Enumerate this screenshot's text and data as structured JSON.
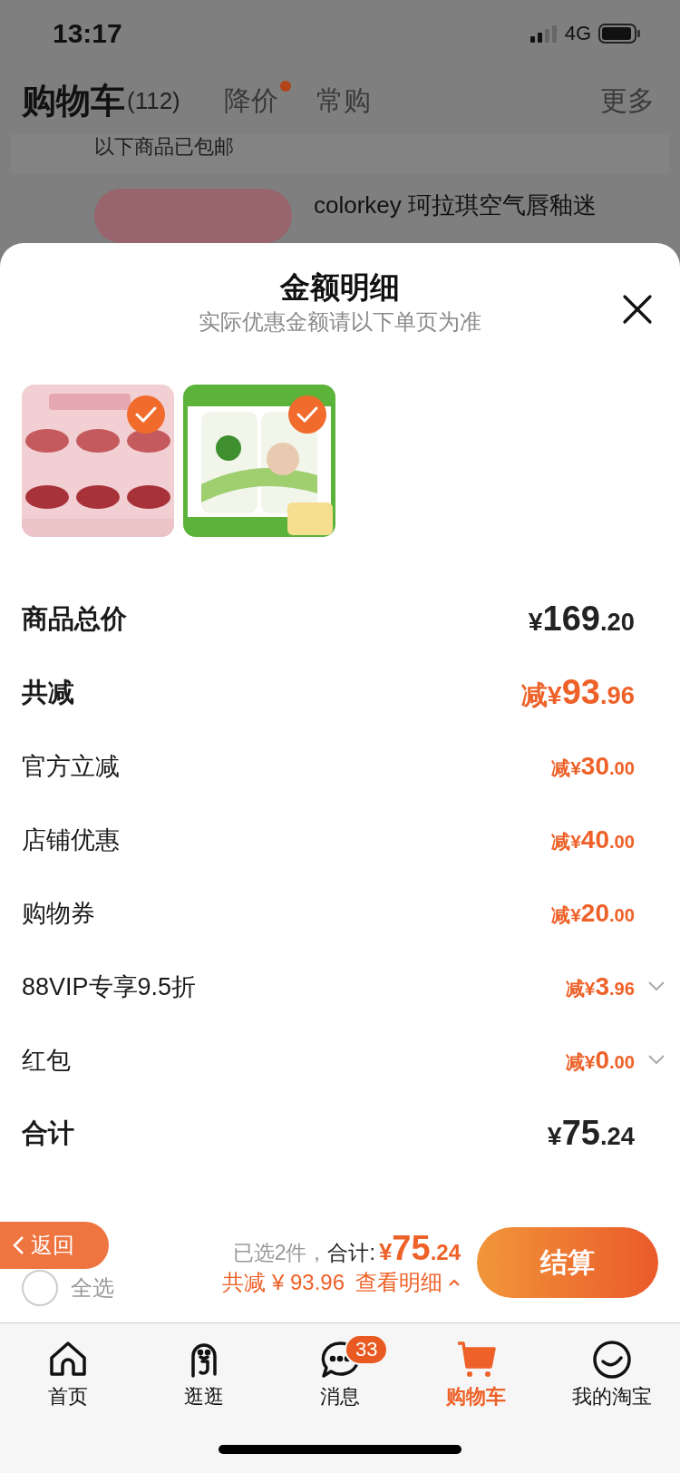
{
  "status_bar": {
    "time": "13:17",
    "network": "4G"
  },
  "header": {
    "title": "购物车",
    "count": "(112)",
    "tabs": [
      {
        "label": "降价",
        "dot": true
      },
      {
        "label": "常购",
        "dot": false
      }
    ],
    "more": "更多"
  },
  "background_cart": {
    "notice": "以下商品已包邮",
    "product_title": "colorkey 珂拉琪空气唇釉迷"
  },
  "sheet": {
    "title": "金额明细",
    "subtitle": "实际优惠金额请以下单页为准",
    "items": [
      {
        "kind": "picture",
        "checked": true
      },
      {
        "kind": "picture",
        "checked": true
      }
    ],
    "rows": [
      {
        "label": "商品总价",
        "major": true,
        "discount": false,
        "prefix": "",
        "currency": "¥",
        "integer": "169",
        "decimal": ".20",
        "expandable": false
      },
      {
        "label": "共减",
        "major": true,
        "discount": true,
        "prefix": "减",
        "currency": "¥",
        "integer": "93",
        "decimal": ".96",
        "expandable": false
      },
      {
        "label": "官方立减",
        "major": false,
        "discount": true,
        "prefix": "减",
        "currency": "¥",
        "integer": "30",
        "decimal": ".00",
        "expandable": false
      },
      {
        "label": "店铺优惠",
        "major": false,
        "discount": true,
        "prefix": "减",
        "currency": "¥",
        "integer": "40",
        "decimal": ".00",
        "expandable": false
      },
      {
        "label": "购物券",
        "major": false,
        "discount": true,
        "prefix": "减",
        "currency": "¥",
        "integer": "20",
        "decimal": ".00",
        "expandable": false
      },
      {
        "label": "88VIP专享9.5折",
        "major": false,
        "discount": true,
        "prefix": "减",
        "currency": "¥",
        "integer": "3",
        "decimal": ".96",
        "expandable": true
      },
      {
        "label": "红包",
        "major": false,
        "discount": true,
        "prefix": "减",
        "currency": "¥",
        "integer": "0",
        "decimal": ".00",
        "expandable": true
      },
      {
        "label": "合计",
        "major": true,
        "discount": false,
        "prefix": "",
        "currency": "¥",
        "integer": "75",
        "decimal": ".24",
        "expandable": false
      }
    ]
  },
  "checkout_bar": {
    "back": "返回",
    "select_all": {
      "label": "全选",
      "checked": false
    },
    "selected_text": "已选2件，",
    "total_label": "合计:",
    "total_currency": "¥",
    "total_integer": "75",
    "total_decimal": ".24",
    "saving": "共减 ¥ 93.96",
    "details_link": "查看明细",
    "checkout": "结算"
  },
  "tab_bar": [
    {
      "label": "首页",
      "selected": false
    },
    {
      "label": "逛逛",
      "selected": false
    },
    {
      "label": "消息",
      "selected": false,
      "badge": "33"
    },
    {
      "label": "购物车",
      "selected": true
    },
    {
      "label": "我的淘宝",
      "selected": false
    }
  ]
}
